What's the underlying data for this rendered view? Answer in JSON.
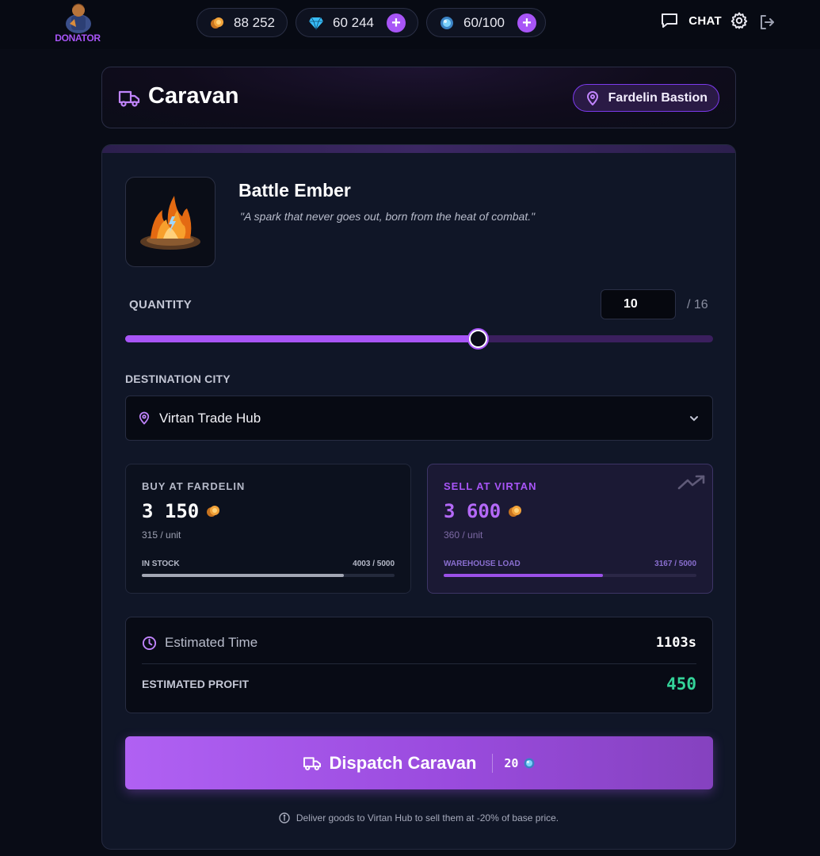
{
  "user": {
    "badge": "DONATOR"
  },
  "currencies": {
    "gold": {
      "icon": "gold-coin-icon",
      "value": "88 252"
    },
    "gems": {
      "icon": "gem-icon",
      "value": "60 244"
    },
    "energy": {
      "icon": "energy-orb-icon",
      "value": "60/100"
    }
  },
  "nav": {
    "chat_label": "CHAT"
  },
  "header": {
    "title": "Caravan",
    "location": "Fardelin Bastion"
  },
  "item": {
    "name": "Battle Ember",
    "description": "\"A spark that never goes out, born from the heat of combat.\""
  },
  "quantity": {
    "label": "QUANTITY",
    "value": "10",
    "max_text": "/ 16",
    "fraction": 0.6
  },
  "destination": {
    "label": "DESTINATION CITY",
    "selected": "Virtan Trade Hub"
  },
  "buy": {
    "title": "BUY AT FARDELIN",
    "total": "3 150",
    "unit": "315 / unit",
    "bar_label": "IN STOCK",
    "bar_value": "4003 / 5000",
    "fraction": 0.8
  },
  "sell": {
    "title": "SELL AT VIRTAN",
    "total": "3 600",
    "unit": "360 / unit",
    "bar_label": "WAREHOUSE LOAD",
    "bar_value": "3167 / 5000",
    "fraction": 0.63
  },
  "summary": {
    "time_label": "Estimated Time",
    "time_value": "1103s",
    "profit_label": "ESTIMATED PROFIT",
    "profit_value": "450"
  },
  "dispatch": {
    "label": "Dispatch Caravan",
    "cost": "20"
  },
  "note": "Deliver goods to Virtan Hub to sell them at -20% of base price.",
  "colors": {
    "accent": "#a855f7",
    "profit": "#34d399",
    "background": "#090c16"
  }
}
